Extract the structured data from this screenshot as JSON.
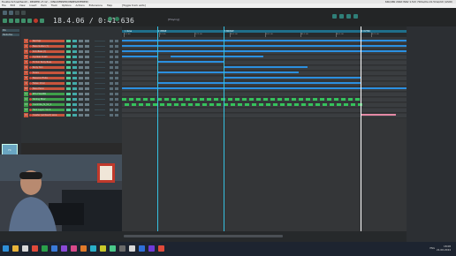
{
  "window": {
    "title": "Tuukka Schnellhenkt – REAPER v7.12 – (UNLICENSED/UNREGISTERED)",
    "status": "64k/48k 24bit WAV 1.5ch 70ms/ms 21.5ms/2ch (ASIO)"
  },
  "menu": {
    "items": [
      "File",
      "Edit",
      "View",
      "Insert",
      "Item",
      "Track",
      "Options",
      "Actions",
      "Extensions",
      "Help"
    ],
    "toggle_label": "[Toggle track exits]"
  },
  "transport": {
    "time": "18.4.06 / 0:41.636",
    "play_state": "[Playing]"
  },
  "left_panel": {
    "buttons": [
      "Mix",
      "Media Bus"
    ],
    "icon_label": "FX",
    "bottom_label": "Red Sprl"
  },
  "tracks": [
    {
      "num": "1",
      "name": "Red Spr",
      "color": "#c8553d"
    },
    {
      "num": "2",
      "name": "Bass Guitar (?)",
      "color": "#c8553d"
    },
    {
      "num": "3",
      "name": "Kick/Bass (?)",
      "color": "#c8553d"
    },
    {
      "num": "4",
      "name": "Cymbal Crash",
      "color": "#c8553d"
    },
    {
      "num": "5",
      "name": "Hi Tom Body Bass",
      "color": "#c8553d"
    },
    {
      "num": "6",
      "name": "Body Tom",
      "color": "#c8553d"
    },
    {
      "num": "7",
      "name": "Snare",
      "color": "#c8553d"
    },
    {
      "num": "8",
      "name": "Bassoon/Flute",
      "color": "#c8553d"
    },
    {
      "num": "9",
      "name": "Fallen Choir",
      "color": "#c8553d"
    },
    {
      "num": "10",
      "name": "Bass Piano",
      "color": "#c8553d"
    },
    {
      "num": "11",
      "name": "BFX FOLDER",
      "color": "#3fa04a"
    },
    {
      "num": "12",
      "name": "Sibling BIG2",
      "color": "#3fa04a"
    },
    {
      "num": "13",
      "name": "marimba_fx_V2_2",
      "color": "#3fa04a"
    },
    {
      "num": "14",
      "name": "Tank Layer: Vol 0",
      "color": "#3fa04a"
    },
    {
      "num": "15",
      "name": "master (ambient) seve",
      "color": "#c8553d"
    }
  ],
  "markers": [
    {
      "label": "1 Verse",
      "x": 0
    },
    {
      "label": "2 VERSE",
      "x": 1
    },
    {
      "label": "3 BRIDGE",
      "x": 2
    },
    {
      "label": "4 OUTRO",
      "x": 3
    }
  ],
  "ruler_ticks": [
    "1.1.00",
    "9.1.00",
    "17.1.00",
    "25.1.00",
    "33.1.00",
    "41.1.00",
    "49.1.00",
    "57.1.00"
  ],
  "taskbar": {
    "time": "18:08",
    "date": "21.06.2024",
    "lang": "ENG"
  },
  "colors": {
    "clip_blue": "#2b8fe0",
    "clip_green": "#35c25c",
    "play_cursor": "#35c0e0",
    "edit_cursor": "#ffffff",
    "marker_bar": "#1f6f8b"
  }
}
